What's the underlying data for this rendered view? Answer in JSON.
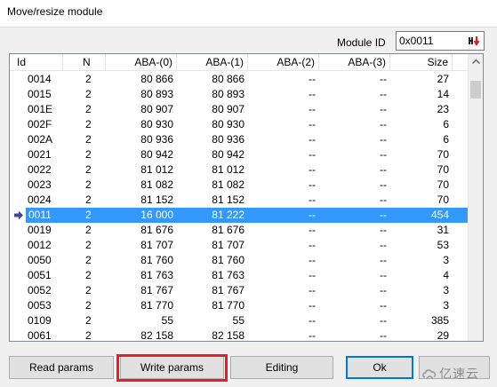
{
  "window": {
    "title": "Move/resize module"
  },
  "module_id": {
    "label": "Module ID",
    "value": "0x0011"
  },
  "columns": [
    "Id",
    "N",
    "ABA-(0)",
    "ABA-(1)",
    "ABA-(2)",
    "ABA-(3)",
    "Size"
  ],
  "rows": [
    [
      "0014",
      "2",
      "80 866",
      "80 866",
      "--",
      "--",
      "27"
    ],
    [
      "0015",
      "2",
      "80 893",
      "80 893",
      "--",
      "--",
      "14"
    ],
    [
      "001E",
      "2",
      "80 907",
      "80 907",
      "--",
      "--",
      "23"
    ],
    [
      "002F",
      "2",
      "80 930",
      "80 930",
      "--",
      "--",
      "6"
    ],
    [
      "002A",
      "2",
      "80 936",
      "80 936",
      "--",
      "--",
      "6"
    ],
    [
      "0021",
      "2",
      "80 942",
      "80 942",
      "--",
      "--",
      "70"
    ],
    [
      "0022",
      "2",
      "81 012",
      "81 012",
      "--",
      "--",
      "70"
    ],
    [
      "0023",
      "2",
      "81 082",
      "81 082",
      "--",
      "--",
      "70"
    ],
    [
      "0024",
      "2",
      "81 152",
      "81 152",
      "--",
      "--",
      "70"
    ],
    [
      "0011",
      "2",
      "16 000",
      "81 222",
      "--",
      "--",
      "454"
    ],
    [
      "0019",
      "2",
      "81 676",
      "81 676",
      "--",
      "--",
      "31"
    ],
    [
      "0012",
      "2",
      "81 707",
      "81 707",
      "--",
      "--",
      "53"
    ],
    [
      "0050",
      "2",
      "81 760",
      "81 760",
      "--",
      "--",
      "3"
    ],
    [
      "0051",
      "2",
      "81 763",
      "81 763",
      "--",
      "--",
      "4"
    ],
    [
      "0052",
      "2",
      "81 767",
      "81 767",
      "--",
      "--",
      "3"
    ],
    [
      "0053",
      "2",
      "81 770",
      "81 770",
      "--",
      "--",
      "3"
    ],
    [
      "0109",
      "2",
      "55",
      "55",
      "--",
      "--",
      "385"
    ],
    [
      "0061",
      "2",
      "82 158",
      "82 158",
      "--",
      "--",
      "29"
    ]
  ],
  "selected_row_index": 9,
  "buttons": {
    "read_params": "Read params",
    "write_params": "Write params",
    "editing": "Editing",
    "ok": "Ok"
  },
  "watermark": {
    "text": "亿速云",
    "icon": "cloud-logo-icon"
  },
  "colors": {
    "selection": "#3399ff",
    "highlight_box": "#e0202a",
    "marker_arrow": "#4b3f9e"
  }
}
